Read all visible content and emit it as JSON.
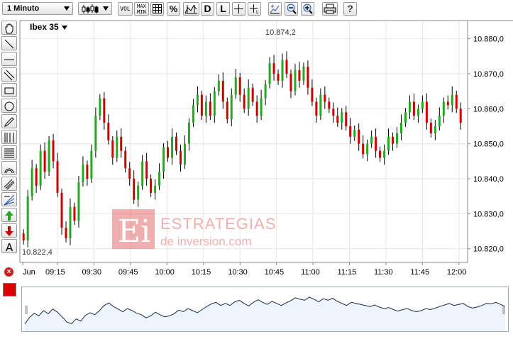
{
  "toolbar": {
    "interval_label": "1 Minuto",
    "chart_type_icon": "candlestick-icon",
    "buttons": [
      {
        "name": "volume-button",
        "label": "VOL"
      },
      {
        "name": "maxmin-button",
        "label": "MAX\nMIN"
      },
      {
        "name": "grid-button",
        "icon": "grid-icon"
      },
      {
        "name": "percent-button",
        "label": "%"
      },
      {
        "name": "compare-button",
        "icon": "compare-icon"
      },
      {
        "name": "daily-button",
        "label": "D"
      },
      {
        "name": "line-button",
        "label": "L"
      },
      {
        "name": "crosshair-button",
        "icon": "crosshair-icon"
      },
      {
        "name": "crosshair-label-button",
        "icon": "crosshair-label-icon"
      },
      {
        "name": "zoom-fit-button",
        "icon": "zoom-fit-icon"
      },
      {
        "name": "zoom-out-button",
        "icon": "zoom-out-icon"
      },
      {
        "name": "zoom-in-button",
        "icon": "zoom-in-icon"
      },
      {
        "name": "print-button",
        "icon": "print-icon"
      },
      {
        "name": "help-button",
        "label": "?"
      }
    ]
  },
  "left_tools": [
    "hand-icon",
    "line-tool-icon",
    "horizontal-line-icon",
    "parallel-lines-icon",
    "rectangle-icon",
    "ellipse-icon",
    "pencil-icon",
    "fibonacci-icon",
    "fibonacci-retracement-icon",
    "arc-icon",
    "channel-icon",
    "gann-icon",
    "arrow-up-icon",
    "arrow-down-icon",
    "text-icon"
  ],
  "colors": {
    "up": "#22aa22",
    "down": "#cc0000",
    "grid": "#e6e6e6",
    "swatch": "#dd0000",
    "overview_line": "#1a2a4a",
    "overview_fill": "#eef4fb"
  },
  "watermark": {
    "logo": "Ei",
    "line1": "ESTRATEGIAS",
    "line2": "de inversion.com"
  },
  "chart_data": {
    "type": "candlestick",
    "title": "Ibex 35",
    "x_ticks": [
      "Jun",
      "09:15",
      "09:30",
      "09:45",
      "10:00",
      "10:15",
      "10:30",
      "10:45",
      "11:00",
      "11:15",
      "11:30",
      "11:45",
      "12:00"
    ],
    "y_ticks": [
      "10.880,0",
      "10.870,0",
      "10.860,0",
      "10.850,0",
      "10.840,0",
      "10.830,0",
      "10.820,0"
    ],
    "ylim": [
      10816.5,
      10885
    ],
    "annotations": {
      "max": "10.874,2",
      "min": "10.822,4"
    },
    "candle_width_minutes": 1,
    "closes": [
      10822.4,
      10835,
      10843,
      10838,
      10848,
      10842,
      10851,
      10845,
      10836,
      10826,
      10823,
      10832,
      10828,
      10839,
      10844,
      10840,
      10848,
      10858,
      10863,
      10856,
      10851,
      10846,
      10852,
      10848,
      10843,
      10840,
      10834,
      10838,
      10845,
      10840,
      10836,
      10838,
      10842,
      10849,
      10846,
      10852,
      10848,
      10844,
      10850,
      10856,
      10861,
      10864,
      10858,
      10862,
      10858,
      10865,
      10868,
      10862,
      10857,
      10864,
      10869,
      10864,
      10860,
      10866,
      10862,
      10858,
      10863,
      10867,
      10873,
      10870,
      10868,
      10874,
      10870,
      10865,
      10871,
      10868,
      10872,
      10866,
      10862,
      10858,
      10864,
      10862,
      10860,
      10858,
      10856,
      10859,
      10855,
      10852,
      10854,
      10850,
      10847,
      10850,
      10852,
      10848,
      10846,
      10848,
      10852,
      10850,
      10853,
      10856,
      10859,
      10862,
      10858,
      10860,
      10862,
      10856,
      10853,
      10855,
      10858,
      10862,
      10861,
      10864,
      10860,
      10856
    ]
  },
  "overview": {
    "series_label": "intraday-overview"
  }
}
